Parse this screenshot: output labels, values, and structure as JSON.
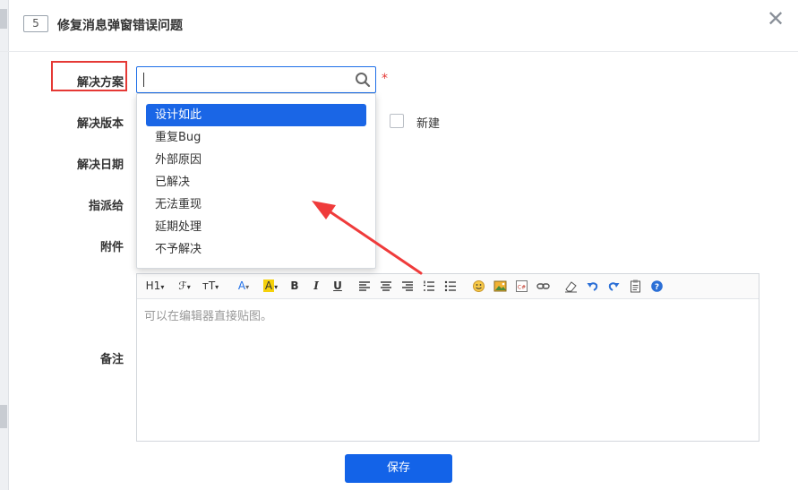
{
  "dialog": {
    "id_badge": "5",
    "title": "修复消息弹窗错误问题",
    "close_glyph": "✕"
  },
  "form": {
    "resolution_label": "解决方案",
    "version_label": "解决版本",
    "date_label": "解决日期",
    "assign_label": "指派给",
    "attachment_label": "附件",
    "notes_label": "备注",
    "required_mark": "*",
    "new_checkbox_label": "新建"
  },
  "dropdown": {
    "options": [
      "设计如此",
      "重复Bug",
      "外部原因",
      "已解决",
      "无法重现",
      "延期处理",
      "不予解决"
    ],
    "selected": "设计如此"
  },
  "editor": {
    "placeholder": "可以在编辑器直接贴图。",
    "toolbar": {
      "heading": "H1",
      "font_family": "ℱ",
      "font_size": "тT",
      "font_color": "A",
      "bg_color": "A",
      "bold": "B",
      "italic": "I",
      "underline": "U"
    }
  },
  "actions": {
    "save_label": "保存"
  },
  "colors": {
    "accent": "#1363e8",
    "highlight_red": "#e53935"
  }
}
